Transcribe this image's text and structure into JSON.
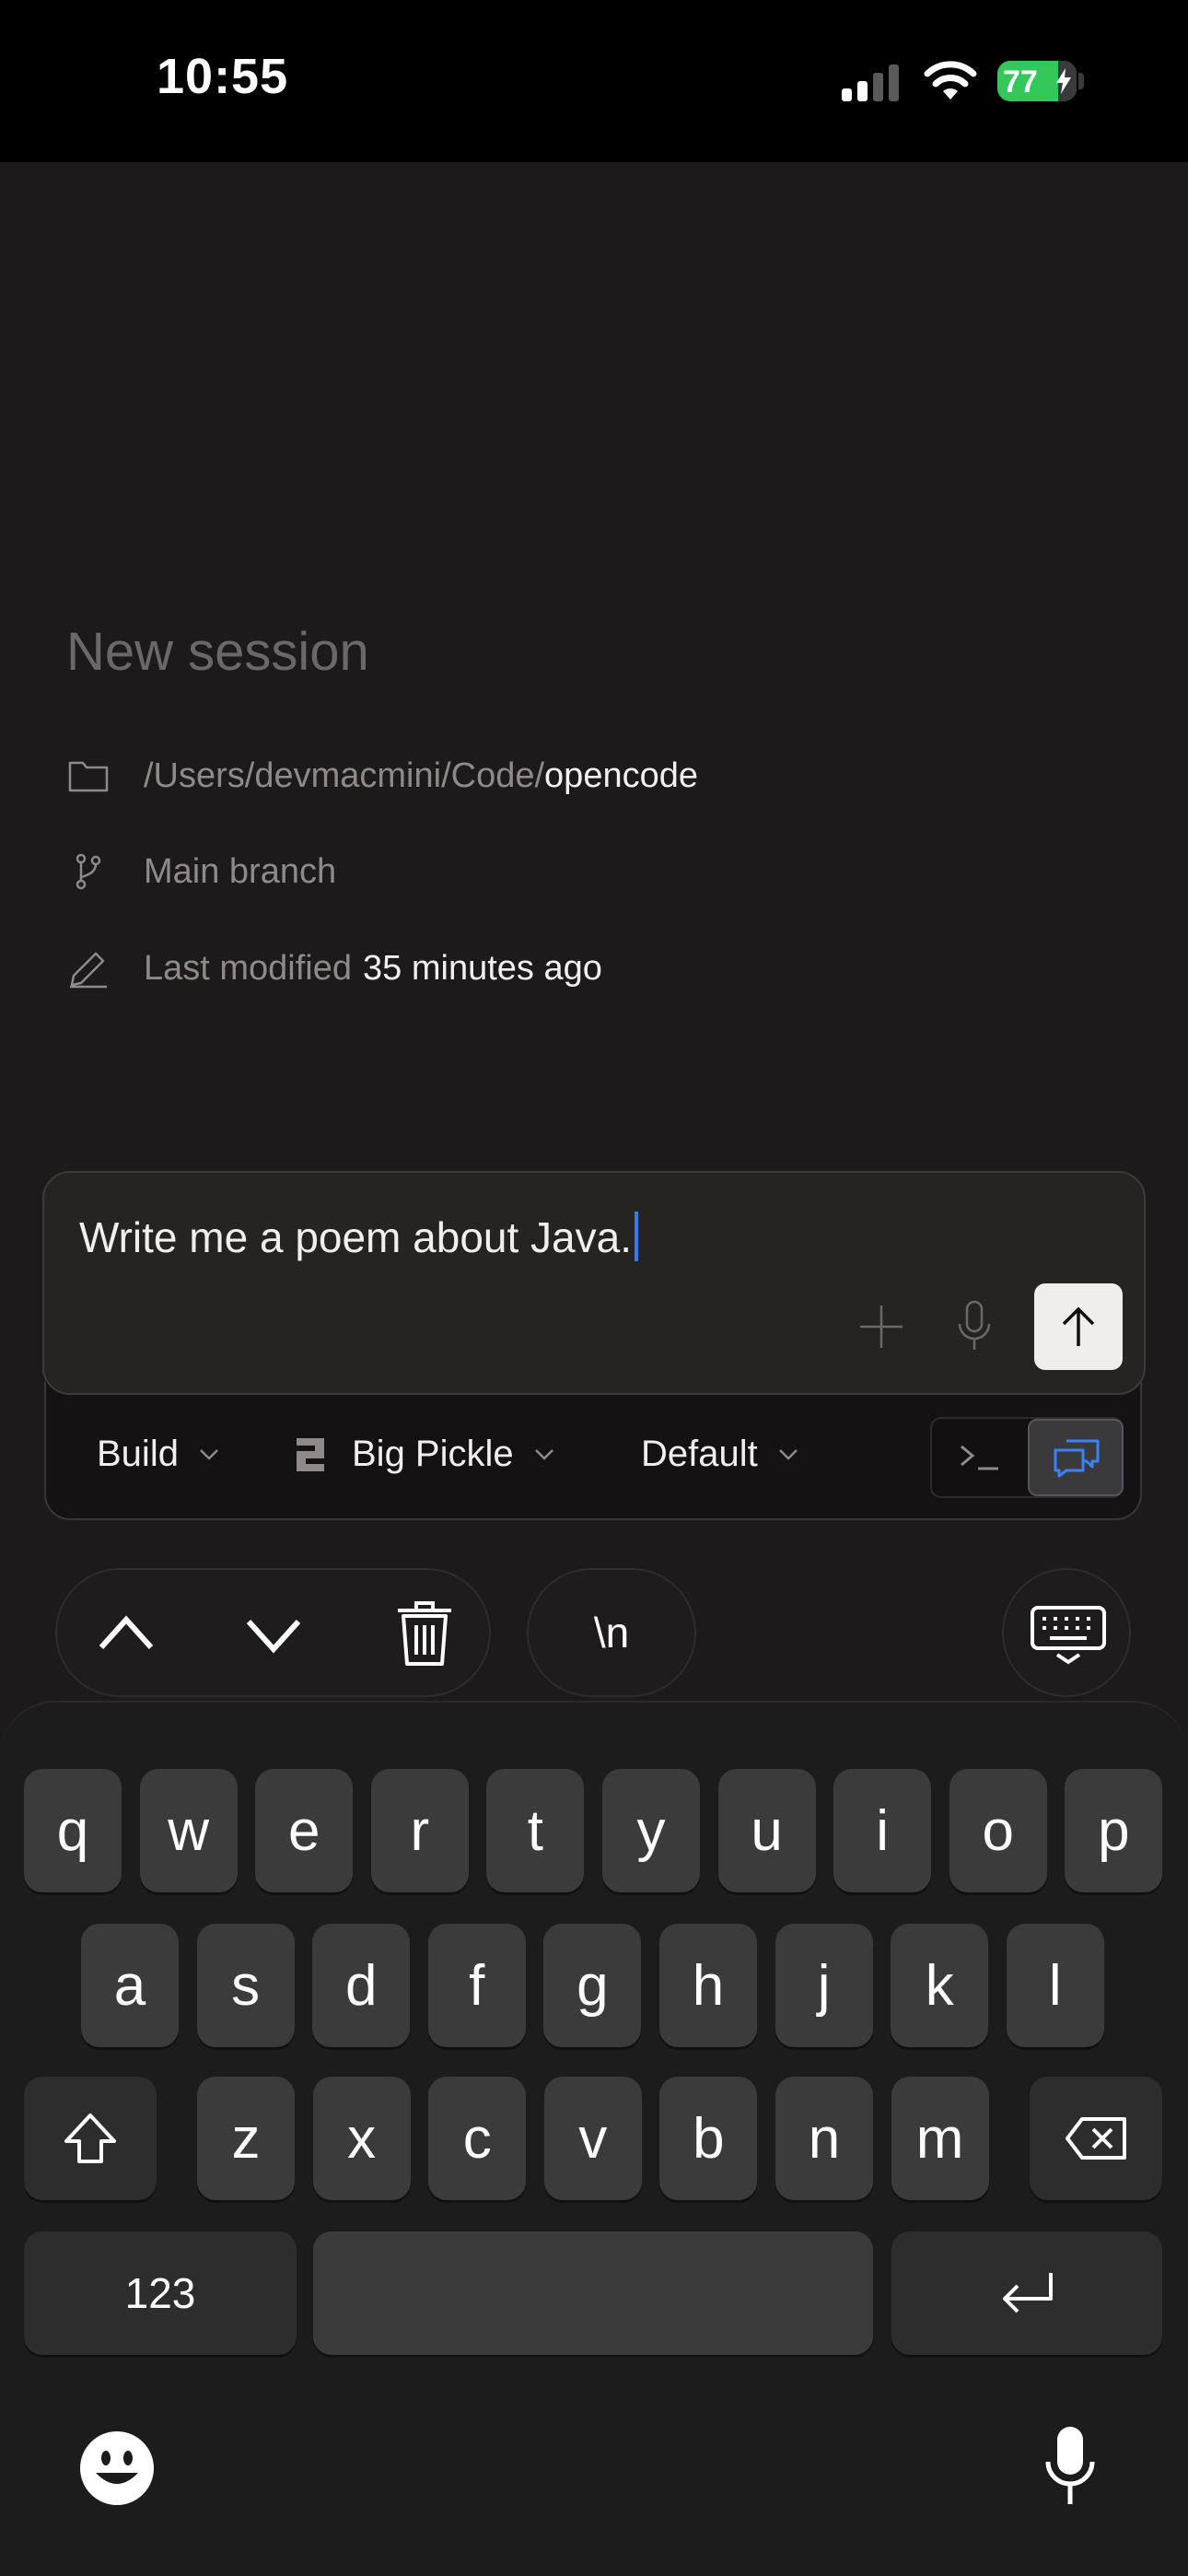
{
  "status_bar": {
    "time": "10:55",
    "battery_level": 77,
    "battery_text": "77"
  },
  "session": {
    "title": "New session",
    "path_prefix": "/Users/devmacmini/Code/",
    "path_name": "opencode",
    "branch": "Main branch",
    "modified_label": "Last modified",
    "modified_value": "35 minutes ago"
  },
  "composer": {
    "text": "Write me a poem about Java."
  },
  "options": {
    "agent": "Build",
    "model": "Big Pickle",
    "variant": "Default"
  },
  "accessory": {
    "newline": "\\n"
  },
  "keyboard": {
    "row1": [
      "q",
      "w",
      "e",
      "r",
      "t",
      "y",
      "u",
      "i",
      "o",
      "p"
    ],
    "row2": [
      "a",
      "s",
      "d",
      "f",
      "g",
      "h",
      "j",
      "k",
      "l"
    ],
    "row3": [
      "z",
      "x",
      "c",
      "v",
      "b",
      "n",
      "m"
    ],
    "numbers_key": "123"
  },
  "icons": {
    "folder": "folder-icon",
    "branch": "git-branch-icon",
    "edit": "pencil-icon",
    "add": "plus-icon",
    "mic": "microphone-icon",
    "send": "arrow-up-icon",
    "terminal": "terminal-icon",
    "chat": "chat-icon"
  },
  "colors": {
    "accent": "#2f7de8",
    "battery": "#34c759",
    "background": "#1c1a1a"
  }
}
